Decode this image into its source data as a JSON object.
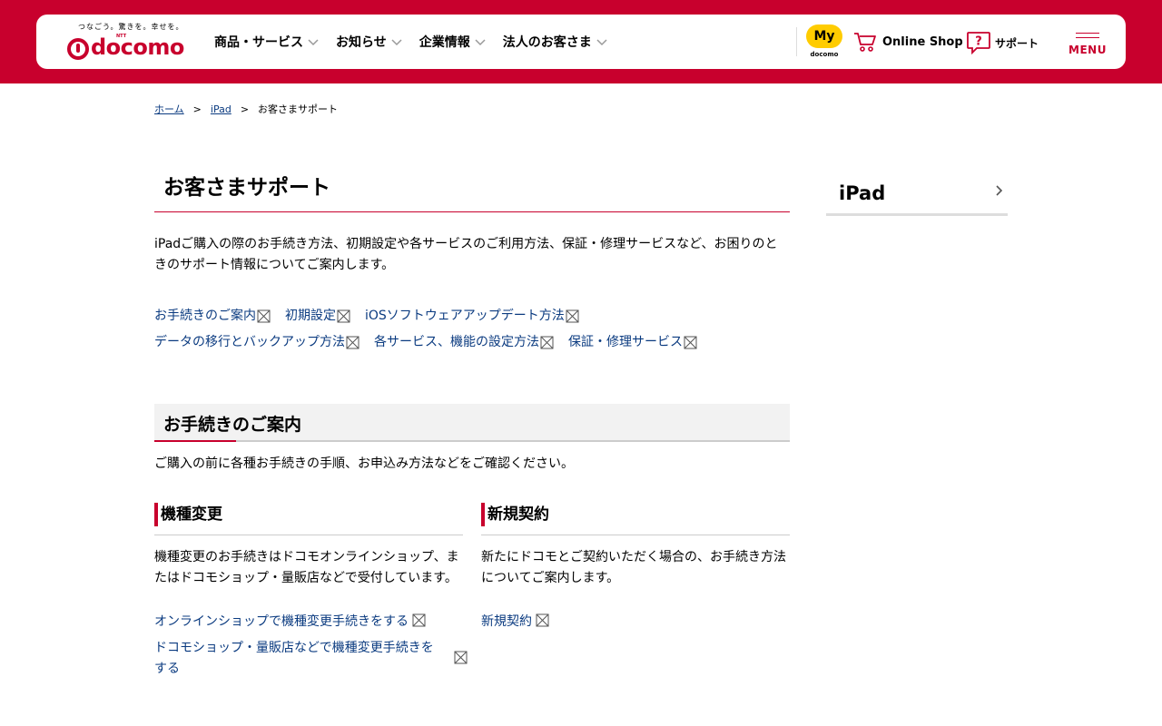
{
  "header": {
    "tagline": "つなごう。驚きを。幸せを。",
    "logo_text": "docomo",
    "logo_ntt": "NTT",
    "nav": [
      {
        "label": "商品・サービス"
      },
      {
        "label": "お知らせ"
      },
      {
        "label": "企業情報"
      },
      {
        "label": "法人のお客さま"
      }
    ],
    "my_label": "My",
    "my_sub": "docomo",
    "online_shop": "Online Shop",
    "support": "サポート",
    "menu": "MENU"
  },
  "breadcrumb": {
    "items": [
      "ホーム",
      "iPad",
      "お客さまサポート"
    ],
    "separator": ">"
  },
  "page": {
    "title": "お客さまサポート",
    "intro": "iPadご購入の際のお手続き方法、初期設定や各サービスのご利用方法、保証・修理サービスなど、お困りのときのサポート情報についてご案内します。",
    "quick_links": {
      "row1": [
        "お手続きのご案内",
        "初期設定",
        "iOSソフトウェアアップデート方法"
      ],
      "row2": [
        "データの移行とバックアップ方法",
        "各サービス、機能の設定方法",
        "保証・修理サービス"
      ]
    },
    "section": {
      "title": "お手続きのご案内",
      "desc": "ご購入の前に各種お手続きの手順、お申込み方法などをご確認ください。",
      "left": {
        "title": "機種変更",
        "desc": "機種変更のお手続きはドコモオンラインショップ、またはドコモショップ・量販店などで受付しています。",
        "links": [
          "オンラインショップで機種変更手続きをする",
          "ドコモショップ・量販店などで機種変更手続きをする"
        ]
      },
      "right": {
        "title": "新規契約",
        "desc": "新たにドコモとご契約いただく場合の、お手続き方法についてご案内します。",
        "links": [
          "新規契約"
        ]
      }
    }
  },
  "sidebar": {
    "title": "iPad"
  },
  "colors": {
    "brand": "#c8002d",
    "link": "#0b3b80",
    "my_yellow": "#ffcc00"
  }
}
